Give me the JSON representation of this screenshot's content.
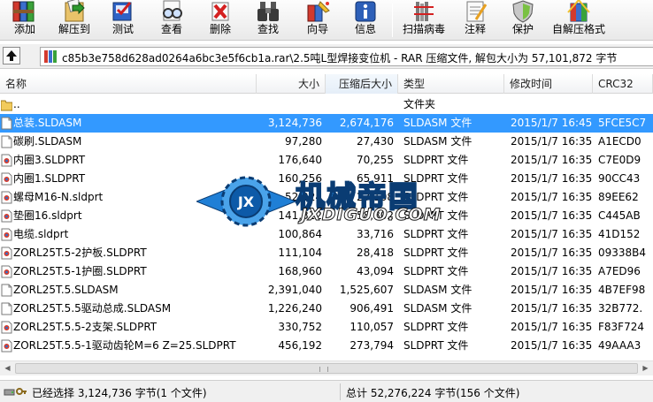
{
  "toolbar": {
    "add": "添加",
    "extract_to": "解压到",
    "test": "测试",
    "view": "查看",
    "delete": "删除",
    "find": "查找",
    "wizard": "向导",
    "info": "信息",
    "virus_scan": "扫描病毒",
    "comment": "注释",
    "protect": "保护",
    "sfx": "自解压格式"
  },
  "address": {
    "path": "c85b3e758d628ad0264a6bc3e5f6cb1a.rar\\2.5吨L型焊接变位机 - RAR 压缩文件, 解包大小为 57,101,872 字节"
  },
  "columns": {
    "name": "名称",
    "size": "大小",
    "packed": "压缩后大小",
    "type": "类型",
    "modified": "修改时间",
    "crc": "CRC32"
  },
  "files": [
    {
      "name": "..",
      "size": "",
      "packed": "",
      "type": "文件夹",
      "modified": "",
      "crc": "",
      "icon": "folder-icon"
    },
    {
      "name": "总装.SLDASM",
      "size": "3,124,736",
      "packed": "2,674,176",
      "type": "SLDASM 文件",
      "modified": "2015/1/7 16:45",
      "crc": "5FCE5C7",
      "icon": "document-icon",
      "selected": true
    },
    {
      "name": "碳刷.SLDASM",
      "size": "97,280",
      "packed": "27,430",
      "type": "SLDASM 文件",
      "modified": "2015/1/7 16:35",
      "crc": "A1ECD0",
      "icon": "document-icon"
    },
    {
      "name": "内圈3.SLDPRT",
      "size": "176,640",
      "packed": "70,255",
      "type": "SLDPRT 文件",
      "modified": "2015/1/7 16:35",
      "crc": "C7E0D9",
      "icon": "sldprt-icon"
    },
    {
      "name": "内圈1.SLDPRT",
      "size": "160,256",
      "packed": "65,911",
      "type": "SLDPRT 文件",
      "modified": "2015/1/7 16:35",
      "crc": "90CC43",
      "icon": "sldprt-icon"
    },
    {
      "name": "螺母M16-N.sldprt",
      "size": "52,224",
      "packed": "23,108",
      "type": "SLDPRT 文件",
      "modified": "2015/1/7 16:35",
      "crc": "89EE62",
      "icon": "sldprt-icon"
    },
    {
      "name": "垫圈16.sldprt",
      "size": "141,312",
      "packed": "58,802",
      "type": "SLDPRT 文件",
      "modified": "2015/1/7 16:35",
      "crc": "C445AB",
      "icon": "sldprt-icon"
    },
    {
      "name": "电缆.sldprt",
      "size": "100,864",
      "packed": "33,716",
      "type": "SLDPRT 文件",
      "modified": "2015/1/7 16:35",
      "crc": "41D152",
      "icon": "sldprt-icon"
    },
    {
      "name": "ZORL25T.5-2护板.SLDPRT",
      "size": "111,104",
      "packed": "28,418",
      "type": "SLDPRT 文件",
      "modified": "2015/1/7 16:35",
      "crc": "09338B4",
      "icon": "sldprt-icon"
    },
    {
      "name": "ZORL25T.5-1护圈.SLDPRT",
      "size": "168,960",
      "packed": "43,094",
      "type": "SLDPRT 文件",
      "modified": "2015/1/7 16:35",
      "crc": "A7ED96",
      "icon": "sldprt-icon"
    },
    {
      "name": "ZORL25T.5.SLDASM",
      "size": "2,391,040",
      "packed": "1,525,607",
      "type": "SLDASM 文件",
      "modified": "2015/1/7 16:35",
      "crc": "4B7EF98",
      "icon": "document-icon"
    },
    {
      "name": "ZORL25T.5.5驱动总成.SLDASM",
      "size": "1,226,240",
      "packed": "906,491",
      "type": "SLDASM 文件",
      "modified": "2015/1/7 16:35",
      "crc": "32B772.",
      "icon": "document-icon"
    },
    {
      "name": "ZORL25T.5.5-2支架.SLDPRT",
      "size": "330,752",
      "packed": "110,057",
      "type": "SLDPRT 文件",
      "modified": "2015/1/7 16:35",
      "crc": "F83F724",
      "icon": "sldprt-icon"
    },
    {
      "name": "ZORL25T.5.5-1驱动齿轮M=6 Z=25.SLDPRT",
      "size": "456,192",
      "packed": "273,794",
      "type": "SLDPRT 文件",
      "modified": "2015/1/7 16:35",
      "crc": "49AAA3",
      "icon": "sldprt-icon"
    }
  ],
  "watermark": {
    "title": "机械帝国",
    "domain": "JXDIGUO.COM",
    "logo": "JX"
  },
  "status": {
    "selected": "已经选择 3,124,736 字节(1 个文件)",
    "total": "总计 52,276,224 字节(156 个文件)"
  }
}
